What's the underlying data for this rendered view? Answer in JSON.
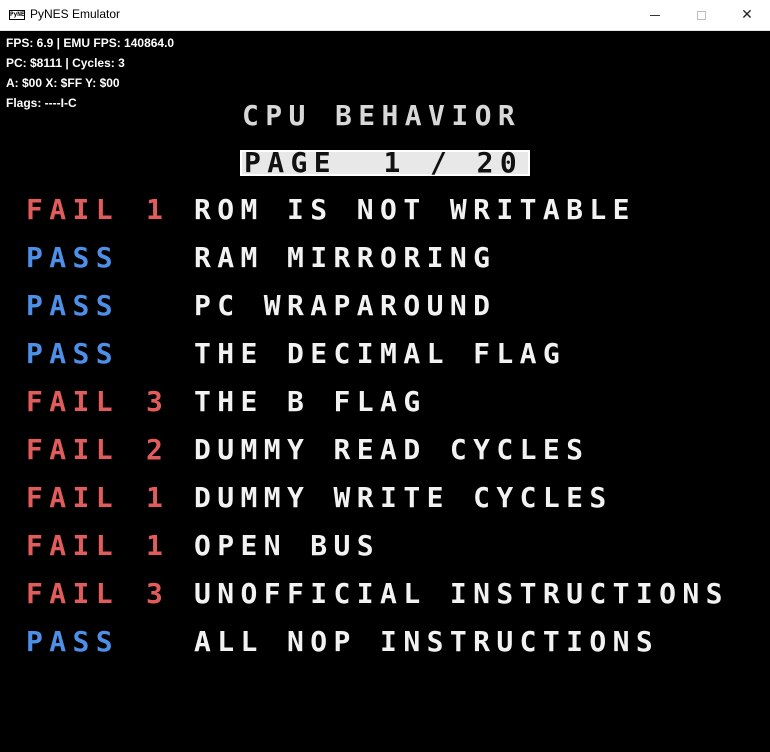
{
  "window": {
    "title": "PyNES Emulator",
    "icon": "nes-app-icon",
    "icon_text": "PyNES"
  },
  "overlay": {
    "fps_line": "FPS: 6.9 | EMU FPS: 140864.0",
    "pc_line": "PC: $8111 | Cycles: 3",
    "reg_line": "A: $00 X: $FF Y: $00",
    "flags_line": "Flags: ----I-C"
  },
  "screen": {
    "heading": "CPU BEHAVIOR",
    "page_label": "PAGE  1 / 20",
    "colors": {
      "fail": "#e35c5c",
      "pass": "#4e8fe8",
      "text": "#f2f2f2",
      "background": "#000000"
    },
    "tests": [
      {
        "status": "FAIL",
        "code": "1",
        "name": "ROM IS NOT WRITABLE"
      },
      {
        "status": "PASS",
        "code": "",
        "name": "RAM MIRRORING"
      },
      {
        "status": "PASS",
        "code": "",
        "name": "PC WRAPAROUND"
      },
      {
        "status": "PASS",
        "code": "",
        "name": "THE DECIMAL FLAG"
      },
      {
        "status": "FAIL",
        "code": "3",
        "name": "THE B FLAG"
      },
      {
        "status": "FAIL",
        "code": "2",
        "name": "DUMMY READ CYCLES"
      },
      {
        "status": "FAIL",
        "code": "1",
        "name": "DUMMY WRITE CYCLES"
      },
      {
        "status": "FAIL",
        "code": "1",
        "name": "OPEN BUS"
      },
      {
        "status": "FAIL",
        "code": "3",
        "name": "UNOFFICIAL INSTRUCTIONS"
      },
      {
        "status": "PASS",
        "code": "",
        "name": "ALL NOP INSTRUCTIONS"
      }
    ]
  }
}
